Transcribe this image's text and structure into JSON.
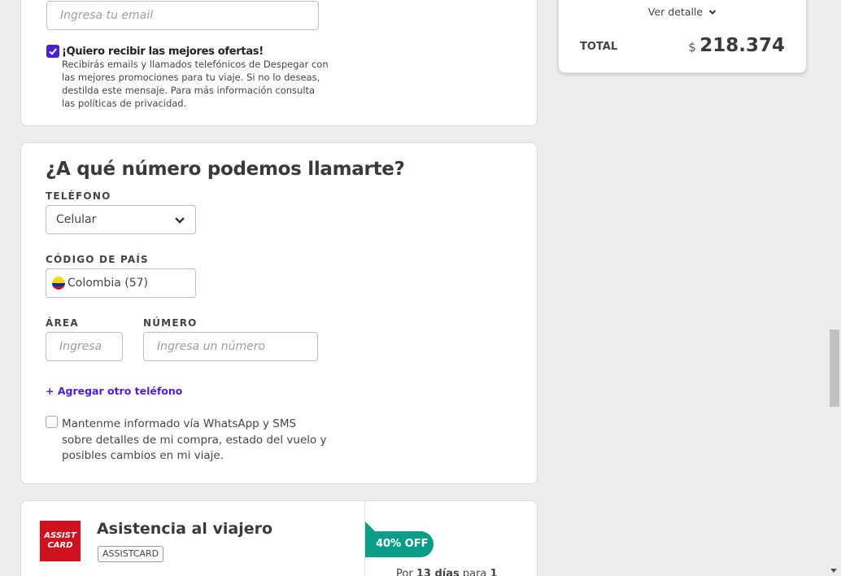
{
  "email_section": {
    "email_placeholder": "Ingresa tu email",
    "offers_title": "¡Quiero recibir las mejores ofertas!",
    "offers_desc_line1": "Recibirás emails y llamados telefónicos de Despegar con",
    "offers_desc_line2": "las mejores promociones para tu viaje. Si no lo deseas,",
    "offers_desc_line3": "destilda este mensaje. Para más información consulta",
    "offers_desc_line4": "las políticas de privacidad."
  },
  "phone_section": {
    "heading": "¿A qué número podemos llamarte?",
    "phone_label": "TELÉFONO",
    "phone_type_value": "Celular",
    "country_label": "CÓDIGO DE PAÍS",
    "country_value": "Colombia (57)",
    "area_label": "ÁREA",
    "area_placeholder": "Ingresa",
    "number_label": "NÚMERO",
    "number_placeholder": "Ingresa un número",
    "add_phone_link": "+ Agregar otro teléfono",
    "whatsapp_line1": "Mantenme informado vía WhatsApp y SMS",
    "whatsapp_line2": "sobre detalles de mi compra, estado del vuelo y",
    "whatsapp_line3": "posibles cambios en mi viaje."
  },
  "assist_section": {
    "logo_line1": "ASSIST",
    "logo_line2": "CARD",
    "title": "Asistencia al viajero",
    "provider_badge": "ASSISTCARD",
    "discount_badge": "40% OFF",
    "duration_prefix": "Por",
    "duration_days": "13 días",
    "duration_mid": "para",
    "duration_people": "1"
  },
  "summary": {
    "detail_link": "Ver detalle",
    "total_label": "TOTAL",
    "currency": "$",
    "total_value": "218.374"
  },
  "colors": {
    "accent_purple": "#4a1fd6",
    "badge_teal": "#0a9e88",
    "assist_red": "#d0121e"
  }
}
